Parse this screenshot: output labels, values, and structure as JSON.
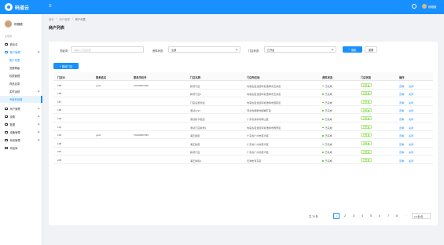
{
  "header": {
    "brand": "码道云",
    "menu_icon": "menu-icon",
    "user": "杨璐璐"
  },
  "sidebar": {
    "user": "杨璐璐",
    "caption": "主导航",
    "items": [
      {
        "label": "首页总"
      },
      {
        "label": "账户管理"
      },
      {
        "label": "账户列表"
      },
      {
        "label": "员额等级"
      },
      {
        "label": "权限管理"
      },
      {
        "label": "商品目录"
      },
      {
        "label": "实时运营"
      },
      {
        "label": "专营商设置"
      },
      {
        "label": "商户管理"
      },
      {
        "label": "设置"
      },
      {
        "label": "数据"
      },
      {
        "label": "设备管理"
      },
      {
        "label": "系统管理"
      },
      {
        "label": "商品库"
      }
    ]
  },
  "breadcrumb": {
    "home": "首页",
    "parent": "商户管理",
    "sep": "/",
    "current": "商户列表"
  },
  "page_title": "商户列表",
  "filters": {
    "keyword_label": "关键词：",
    "keyword_placeholder": "请输入门店名称",
    "status_label": "资料状态：",
    "status_value": "全部",
    "store_label": "门店状态：",
    "store_value": "已开启",
    "search_btn": "搜索",
    "reset_btn": "重置"
  },
  "add_btn": "+ 新增门店",
  "table": {
    "headers": [
      "门店ID",
      "联系姓名",
      "联系手机号",
      "门店名称",
      "门店所在地",
      "资料状态",
      "门店状态",
      "操作"
    ],
    "rows": [
      {
        "id": "185",
        "name": "yoaf",
        "phone": "13349567095",
        "store": "新增门店",
        "addr": "内蒙古自治区呼和浩特市玉泉区",
        "info": "已完成",
        "state": "已开启",
        "a1": "查看",
        "a2": "关闭"
      },
      {
        "id": "186",
        "name": "",
        "phone": "",
        "store": "新增门店1",
        "addr": "内蒙古自治区呼和浩特市玉泉区",
        "info": "已完成",
        "state": "已开启",
        "a1": "查看",
        "a2": "关闭"
      },
      {
        "id": "187",
        "name": "",
        "phone": "",
        "store": "门店设置测试",
        "addr": "内蒙古自治区呼和浩特市回民区",
        "info": "已完成",
        "state": "已开启",
        "a1": "查看",
        "a2": "关闭"
      },
      {
        "id": "188",
        "name": "",
        "phone": "",
        "store": "测试1212",
        "addr": "河北省邯郸市邯郸矿区",
        "info": "已完成",
        "state": "已开启",
        "a1": "查看",
        "a2": "关闭"
      },
      {
        "id": "190",
        "name": "",
        "phone": "",
        "store": "测试的卡批店",
        "addr": "广东省深圳市南山区",
        "info": "已完成",
        "state": "已开启",
        "a1": "查看",
        "a2": "关闭"
      },
      {
        "id": "191",
        "name": "",
        "phone": "",
        "store": "测试门店新增1",
        "addr": "内蒙古自治区呼和浩特市赛罕区",
        "info": "已完成",
        "state": "已开启",
        "a1": "查看",
        "a2": "关闭"
      },
      {
        "id": "193",
        "name": "yoaf",
        "phone": "13349567095",
        "store": "海王新街",
        "addr": "广东省广州市荔湾区",
        "info": "已完成",
        "state": "已开启",
        "a1": "查看",
        "a2": "关闭"
      },
      {
        "id": "198",
        "name": "",
        "phone": "",
        "store": "海王新街",
        "addr": "广东省广州市荔湾区",
        "info": "已完成",
        "state": "已开启",
        "a1": "查看",
        "a2": "关闭"
      },
      {
        "id": "204",
        "name": "",
        "phone": "",
        "store": "新增门店",
        "addr": "广东省广州市荔湾区",
        "info": "已完成",
        "state": "已开启",
        "a1": "查看",
        "a2": "关闭"
      },
      {
        "id": "205",
        "name": "",
        "phone": "",
        "store": "海王新街2",
        "addr": "天津市河东区",
        "info": "已完成",
        "state": "已开启",
        "a1": "查看",
        "a2": "关闭"
      }
    ]
  },
  "pagination": {
    "total": "共 76 条",
    "prev": "‹",
    "next": "›",
    "pages": [
      "1",
      "2",
      "3",
      "4",
      "5",
      "6",
      "7",
      "8"
    ],
    "current": "1",
    "page_size": "10 条/页"
  }
}
